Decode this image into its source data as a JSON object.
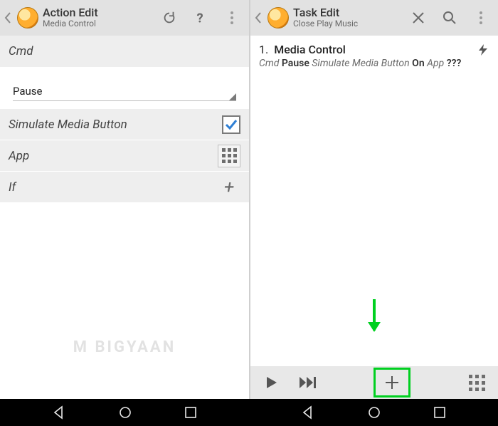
{
  "left": {
    "header": {
      "title": "Action Edit",
      "subtitle": "Media Control"
    },
    "sections": {
      "cmd_label": "Cmd",
      "cmd_value": "Pause",
      "simulate_label": "Simulate Media Button",
      "simulate_checked": true,
      "app_label": "App",
      "if_label": "If"
    }
  },
  "right": {
    "header": {
      "title": "Task Edit",
      "subtitle": "Close Play Music"
    },
    "task": {
      "num": "1.",
      "title": "Media Control",
      "sub_cmd": "Cmd",
      "sub_val": "Pause",
      "sub_sim": "Simulate Media Button",
      "sub_on": "On",
      "sub_app": "App",
      "sub_q": "???"
    }
  },
  "watermark": "M  BIGYAAN"
}
